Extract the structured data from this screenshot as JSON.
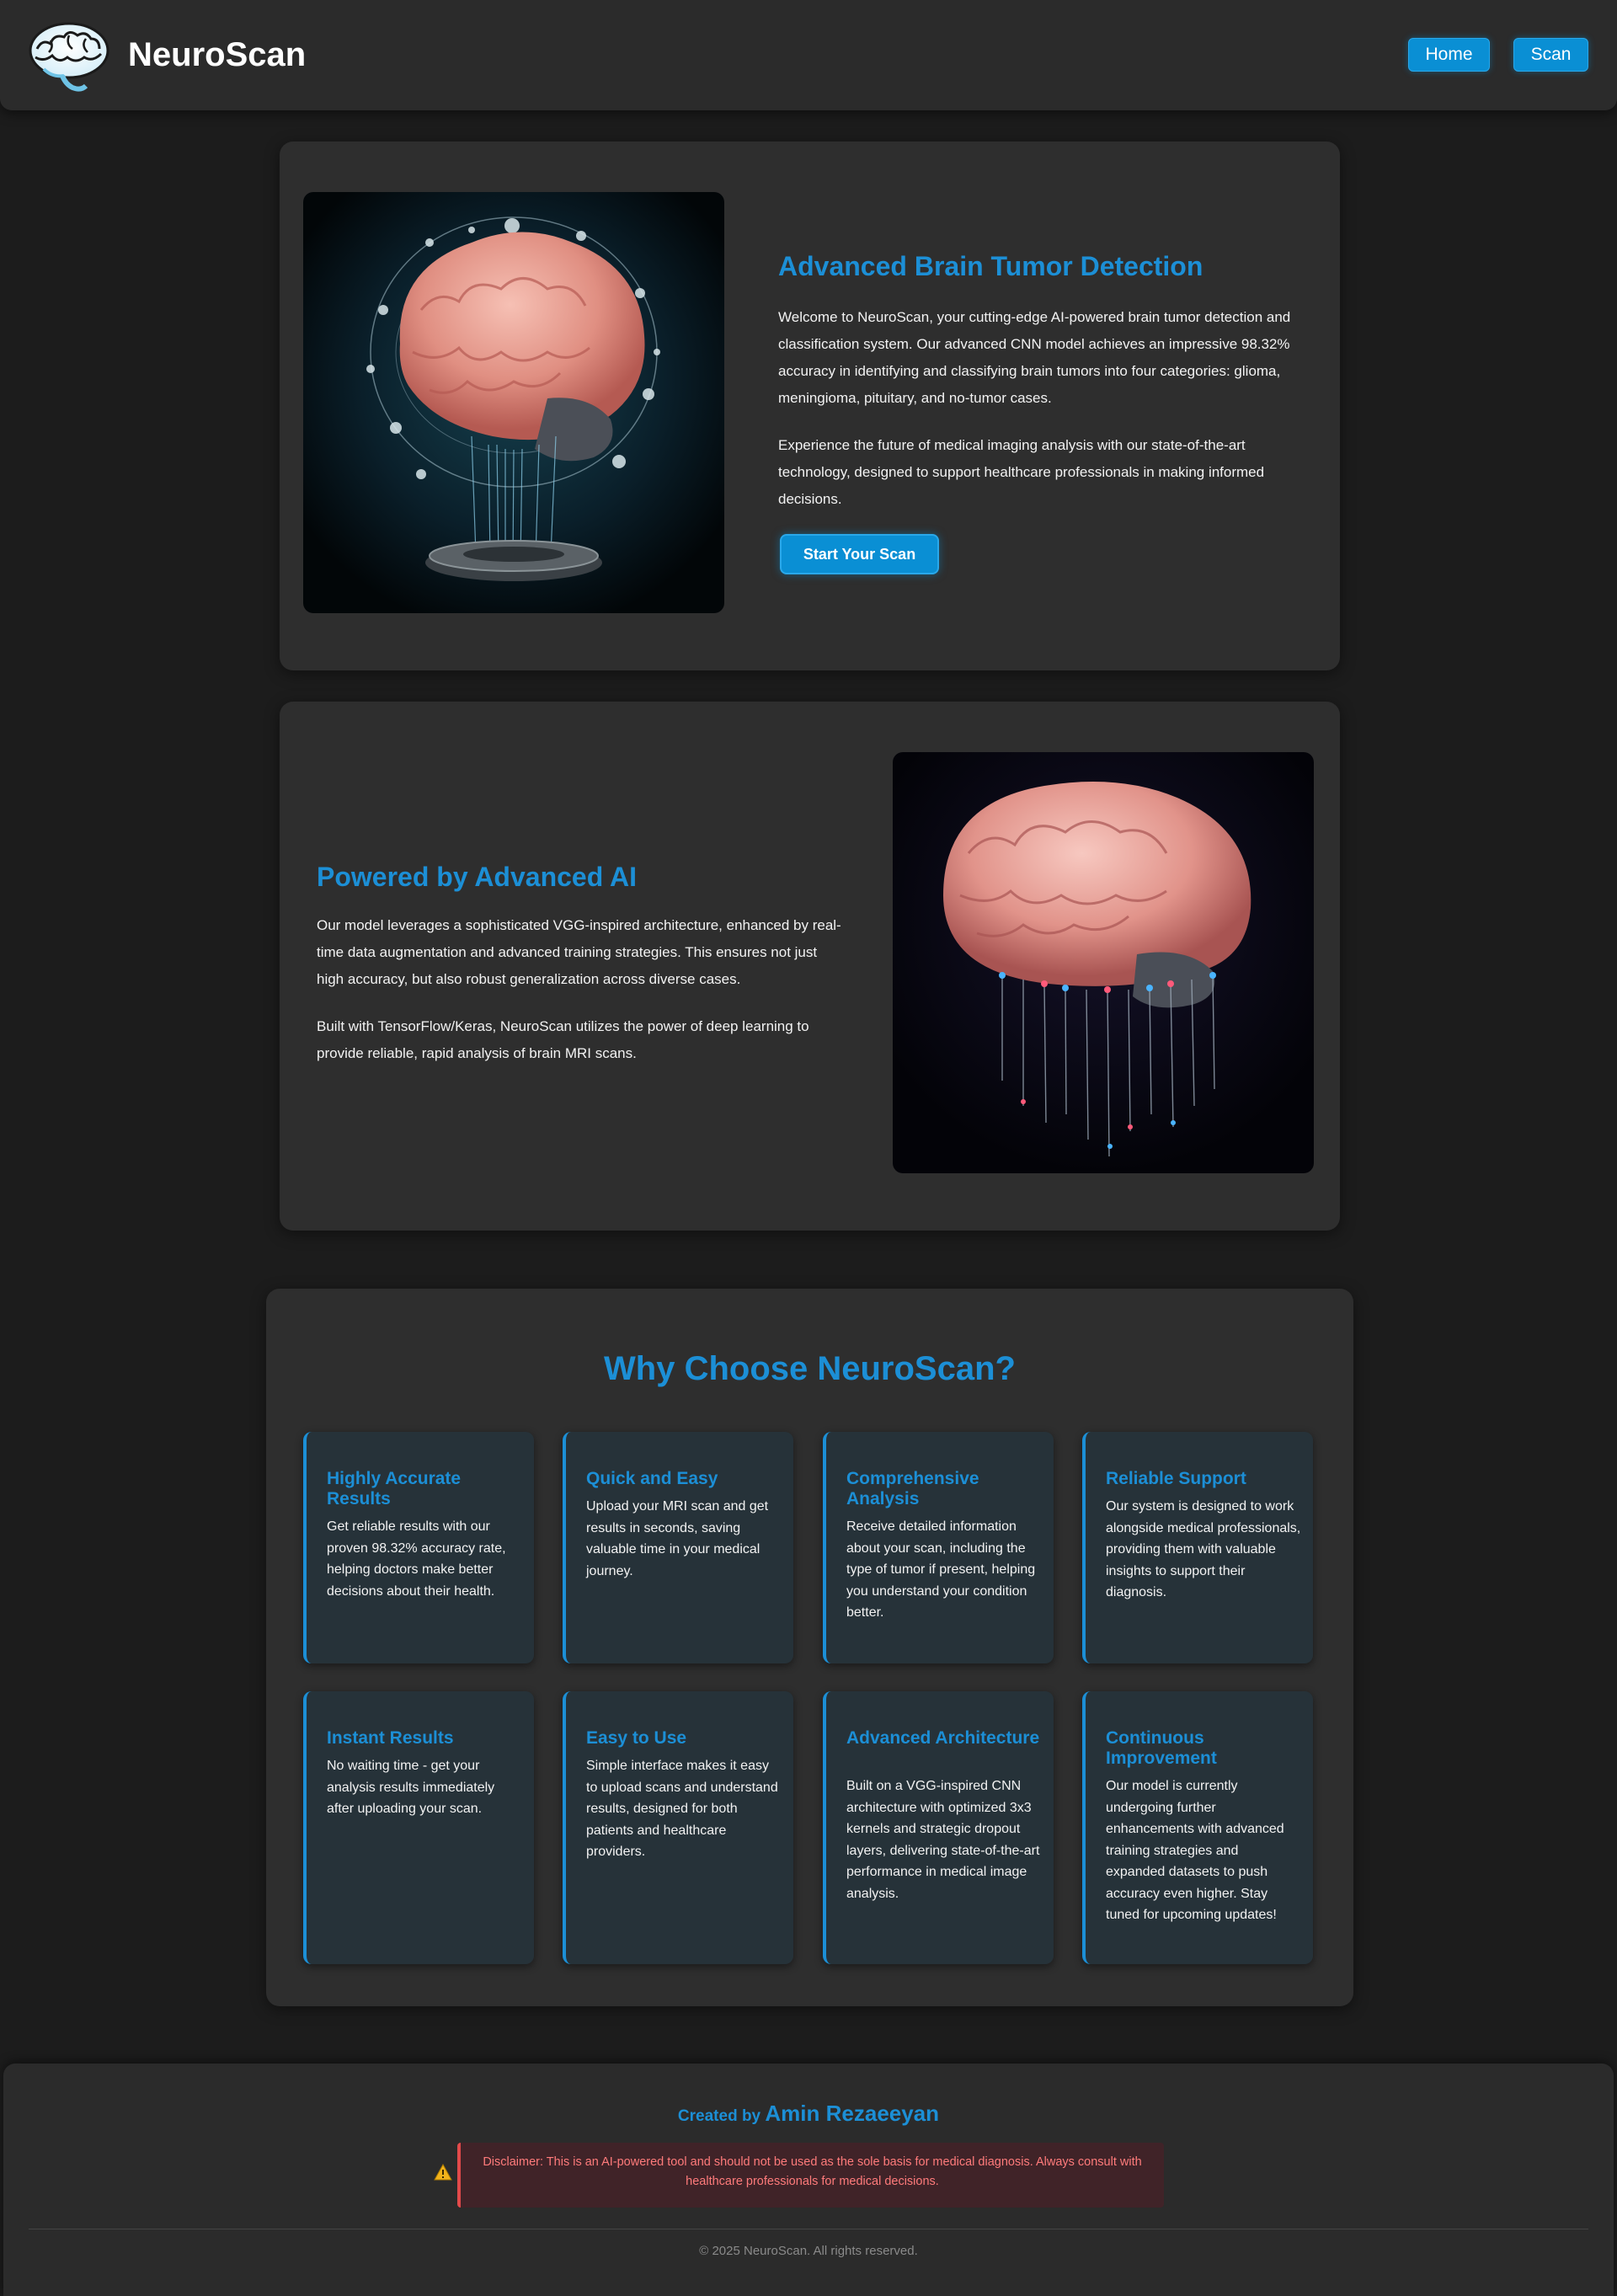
{
  "header": {
    "brand": "NeuroScan",
    "logo_icon": "brain-logo-icon",
    "nav": [
      {
        "label": "Home"
      },
      {
        "label": "Scan"
      }
    ]
  },
  "hero": {
    "title": "Advanced Brain Tumor Detection",
    "paragraphs": [
      "Welcome to NeuroScan, your cutting-edge AI-powered brain tumor detection and classification system. Our advanced CNN model achieves an impressive 98.32% accuracy in identifying and classifying brain tumors into four categories: glioma, meningioma, pituitary, and no-tumor cases.",
      "Experience the future of medical imaging analysis with our state-of-the-art technology, designed to support healthcare professionals in making informed decisions."
    ],
    "cta": "Start Your Scan"
  },
  "ai": {
    "title": "Powered by Advanced AI",
    "paragraphs": [
      "Our model leverages a sophisticated VGG-inspired architecture, enhanced by real-time data augmentation and advanced training strategies. This ensures not just high accuracy, but also robust generalization across diverse cases.",
      "Built with TensorFlow/Keras, NeuroScan utilizes the power of deep learning to provide reliable, rapid analysis of brain MRI scans."
    ]
  },
  "why": {
    "title": "Why Choose NeuroScan?",
    "features": [
      {
        "title": "Highly Accurate Results",
        "text": "Get reliable results with our proven 98.32% accuracy rate, helping doctors make better decisions about their health."
      },
      {
        "title": "Quick and Easy",
        "text": "Upload your MRI scan and get results in seconds, saving valuable time in your medical journey."
      },
      {
        "title": "Comprehensive Analysis",
        "text": "Receive detailed information about your scan, including the type of tumor if present, helping you understand your condition better."
      },
      {
        "title": "Reliable Support",
        "text": "Our system is designed to work alongside medical professionals, providing them with valuable insights to support their diagnosis."
      },
      {
        "title": "Instant Results",
        "text": "No waiting time - get your analysis results immediately after uploading your scan."
      },
      {
        "title": "Easy to Use",
        "text": "Simple interface makes it easy to upload scans and understand results, designed for both patients and healthcare providers."
      },
      {
        "title": "Advanced Architecture",
        "text": "Built on a VGG-inspired CNN architecture with optimized 3x3 kernels and strategic dropout layers, delivering state-of-the-art performance in medical image analysis."
      },
      {
        "title": "Continuous Improvement",
        "text": "Our model is currently undergoing further enhancements with advanced training strategies and expanded datasets to push accuracy even higher. Stay tuned for upcoming updates!"
      }
    ]
  },
  "footer": {
    "created_prefix": "Created by ",
    "author": "Amin Rezaeeyan",
    "disclaimer_icon": "warning-icon",
    "disclaimer": "Disclaimer: This is an AI-powered tool and should not be used as the sole basis for medical diagnosis. Always consult with healthcare professionals for medical decisions.",
    "copyright": "© 2025 NeuroScan. All rights reserved."
  },
  "colors": {
    "accent": "#1c8fd6",
    "button": "#0a8fd4",
    "background": "#1c1c1c",
    "card": "#2e2e2e",
    "feature_card": "#263239",
    "disclaimer_bg": "#402328",
    "disclaimer_text": "#ff7b7b"
  }
}
